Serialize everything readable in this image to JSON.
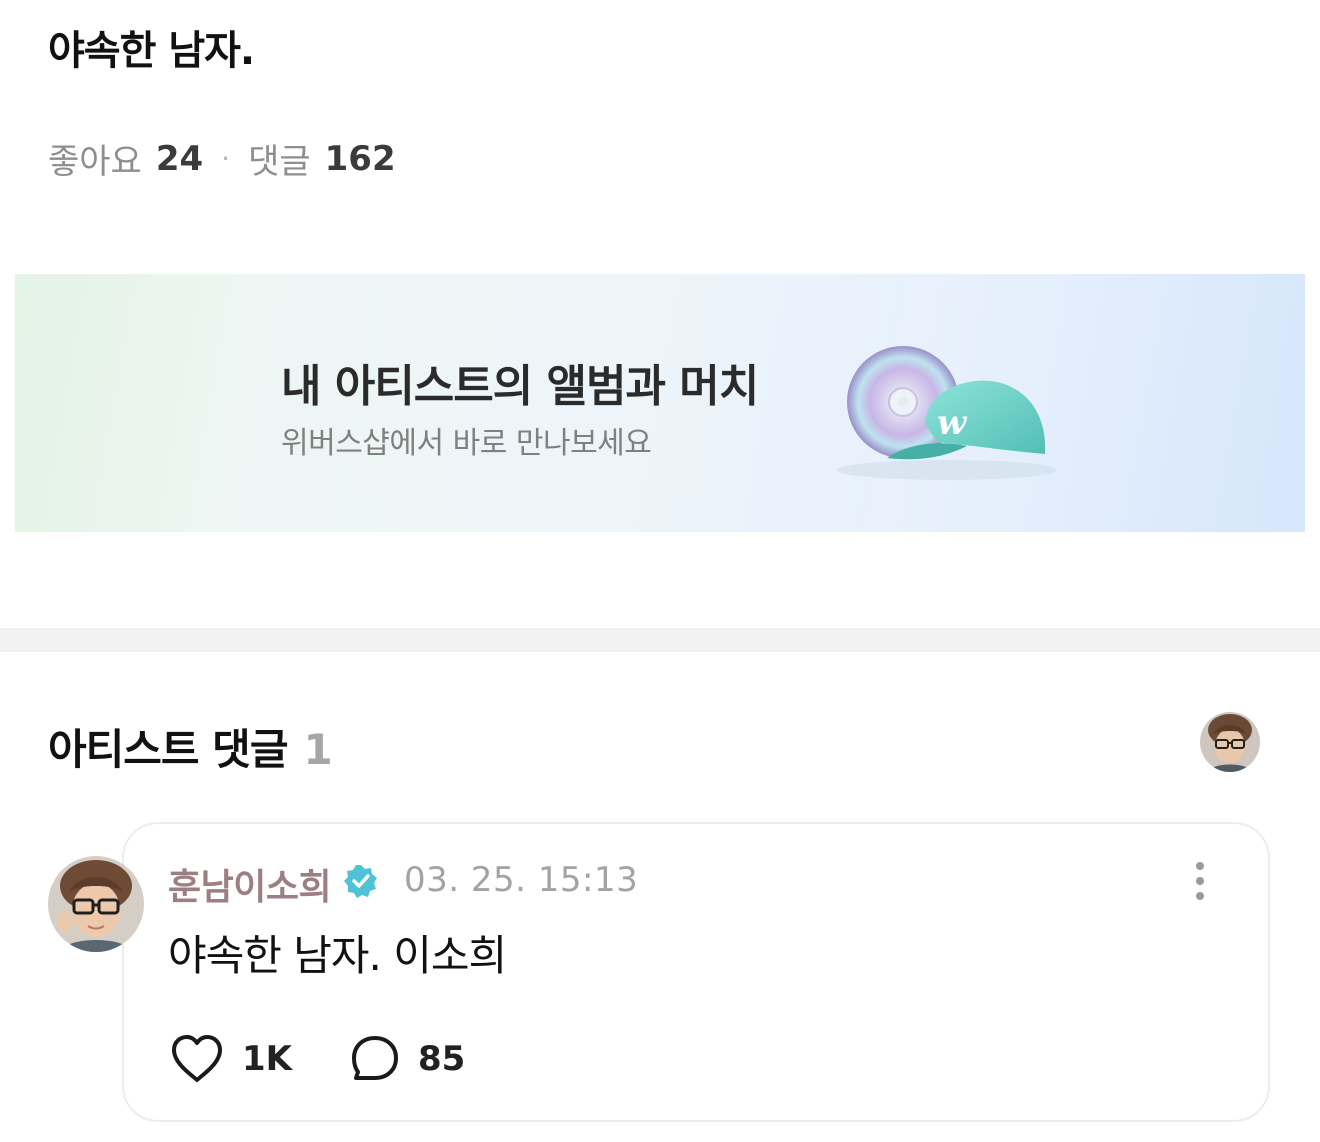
{
  "post": {
    "title": "야속한 남자.",
    "likes_label": "좋아요",
    "likes_count": "24",
    "separator": "·",
    "comments_label": "댓글",
    "comments_count": "162"
  },
  "banner": {
    "title": "내 아티스트의 앨범과 머치",
    "subtitle": "위버스샵에서 바로 만나보세요",
    "cap_logo": "w"
  },
  "artist_comments": {
    "heading": "아티스트 댓글",
    "count": "1"
  },
  "comment": {
    "author": "훈남이소희",
    "timestamp": "03. 25. 15:13",
    "text": "야속한 남자. 이소희",
    "likes": "1K",
    "replies": "85"
  },
  "icons": {
    "verified": "verified-badge-icon",
    "more": "more-vertical-icon",
    "like": "heart-outline-icon",
    "reply": "speech-bubble-icon"
  },
  "colors": {
    "verified": "#4fc3d5",
    "author": "#9c7f82",
    "cap": "#6fd3c9"
  }
}
